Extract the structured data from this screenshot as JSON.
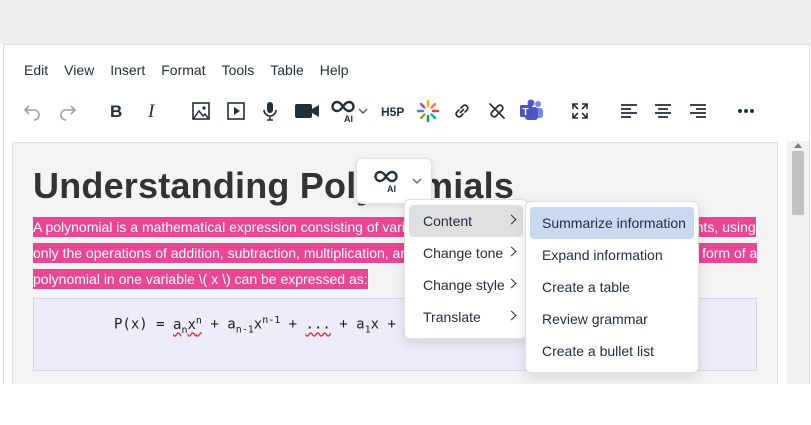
{
  "menubar": {
    "items": [
      "Edit",
      "View",
      "Insert",
      "Format",
      "Tools",
      "Table",
      "Help"
    ]
  },
  "toolbar": {
    "icons": [
      "undo-icon",
      "redo-icon",
      "bold-icon",
      "italic-icon",
      "image-icon",
      "media-icon",
      "microphone-icon",
      "video-camera-icon",
      "ai-icon",
      "chevron-down-icon",
      "h5p-icon",
      "sparkle-icon",
      "link-icon",
      "unlink-icon",
      "teams-icon",
      "fullscreen-icon",
      "align-left-icon",
      "align-center-icon",
      "align-right-icon",
      "more-icon"
    ],
    "h5p_label": "H5P",
    "ai_label": "AI"
  },
  "document": {
    "heading": "Understanding Polynomials",
    "paragraph": "A polynomial is a mathematical expression consisting of variables (also called indeterminates) and coefficients, using only the operations of addition, subtraction, multiplication, and non-negative integer exponents. The general form of a polynomial in one variable \\( x \\) can be expressed as:",
    "formula_prefix": "P(x) = ",
    "formula_a": "a",
    "formula_sub_n": "n",
    "formula_x": "x",
    "formula_sup_n": "n",
    "formula_plus": " + ",
    "formula_sub_n1": "n-1",
    "formula_sup_n1": "n-1",
    "formula_dots": "...",
    "formula_sub_1": "1",
    "formula_tail": "x + "
  },
  "ai_popup": {
    "label": "AI"
  },
  "context_menu": {
    "items": [
      "Content",
      "Change tone",
      "Change style",
      "Translate"
    ],
    "active": "Content"
  },
  "submenu": {
    "items": [
      "Summarize information",
      "Expand information",
      "Create a table",
      "Review grammar",
      "Create a bullet list"
    ],
    "highlighted": "Summarize information"
  },
  "colors": {
    "selection": "#e94693",
    "formula_bg": "#ececfa",
    "menu_highlight": "#c9daf0",
    "text": "#222f3e"
  }
}
